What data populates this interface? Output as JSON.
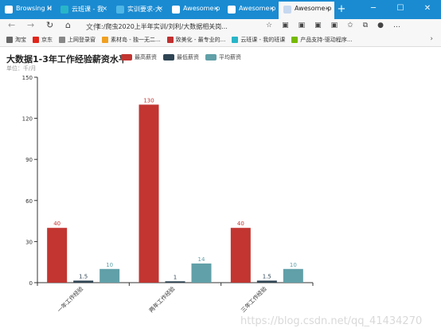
{
  "browser": {
    "tabs": [
      {
        "label": "Browsing H",
        "icon": "document-icon",
        "color": "#ffffff",
        "active": false
      },
      {
        "label": "云班课 - 我",
        "icon": "cloud-class-icon",
        "color": "#28b5c8",
        "active": false
      },
      {
        "label": "实训要求-大",
        "icon": "cloud-icon",
        "color": "#4fb7e6",
        "active": false
      },
      {
        "label": "Awesome-p",
        "icon": "document-icon",
        "color": "#ffffff",
        "active": false
      },
      {
        "label": "Awesome-p",
        "icon": "document-icon",
        "color": "#ffffff",
        "active": false
      },
      {
        "label": "Awesome-p",
        "icon": "document-icon",
        "color": "#ffffff",
        "active": true
      }
    ],
    "new_tab_label": "+",
    "window_buttons": {
      "minimize": "─",
      "maximize": "☐",
      "close": "✕"
    },
    "address": {
      "info_label": "文件",
      "url": "E:/爬虫2020上半年实训/刘利/大数据相关岗..."
    },
    "bookmarks": [
      {
        "label": "淘宝",
        "icon": "bookmark-icon",
        "color": "#666666"
      },
      {
        "label": "京东",
        "icon": "jd-icon",
        "color": "#e1251b"
      },
      {
        "label": "上网登录窗",
        "icon": "page-icon",
        "color": "#888888"
      },
      {
        "label": "素材岛 - 独一无二...",
        "icon": "island-icon",
        "color": "#f0a020"
      },
      {
        "label": "致美化 - 最专业的...",
        "icon": "paint-icon",
        "color": "#c03030"
      },
      {
        "label": "云班课 - 我的班课",
        "icon": "cloud-class-icon",
        "color": "#28b5c8"
      },
      {
        "label": "产品支持-驱动程序...",
        "icon": "nvidia-icon",
        "color": "#76b900"
      }
    ]
  },
  "chart_title": "大数据1-3年工作经验薪资水平",
  "unit_label": "单位：千/月",
  "watermark": "https://blog.csdn.net/qq_41434270",
  "chart_data": {
    "type": "bar",
    "title": "大数据1-3年工作经验薪资水平",
    "subtitle": "单位：千/月",
    "categories": [
      "一年工作经验",
      "两年工作经验",
      "三年工作经验"
    ],
    "series": [
      {
        "name": "最高薪资",
        "values": [
          40,
          130,
          40
        ],
        "color": "#c23531"
      },
      {
        "name": "最低薪资",
        "values": [
          1.5,
          1,
          1.5
        ],
        "color": "#2f4554"
      },
      {
        "name": "平均薪资",
        "values": [
          10,
          14,
          10
        ],
        "color": "#61a0a8"
      }
    ],
    "ylim": [
      0,
      150
    ],
    "yticks": [
      0,
      30,
      60,
      90,
      120,
      150
    ],
    "legend_position": "top",
    "grid": false
  }
}
